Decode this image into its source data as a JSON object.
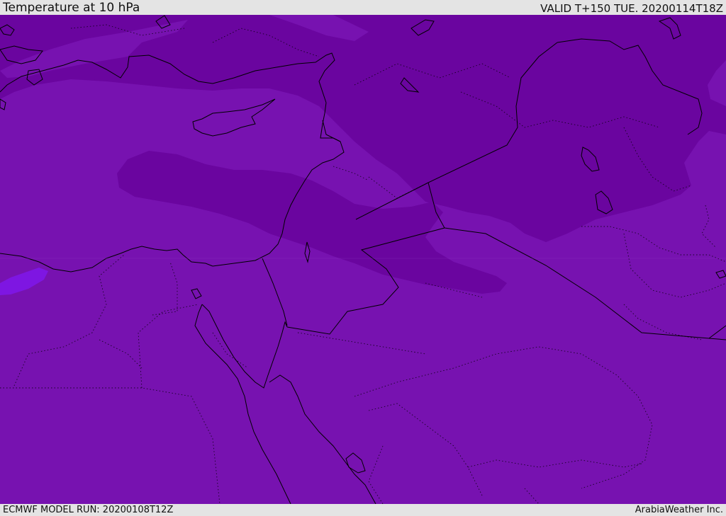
{
  "header": {
    "title": "Temperature at 10 hPa",
    "valid": "VALID T+150 TUE. 20200114T18Z"
  },
  "footer": {
    "model_run": "ECMWF MODEL RUN: 20200108T12Z",
    "credit": "ArabiaWeather Inc."
  },
  "map": {
    "colors": {
      "background_band": "#7712b0",
      "cold_band": "#6a059f",
      "warm_spot": "#7e16e2",
      "coastline": "#000000",
      "border": "#000000"
    }
  }
}
